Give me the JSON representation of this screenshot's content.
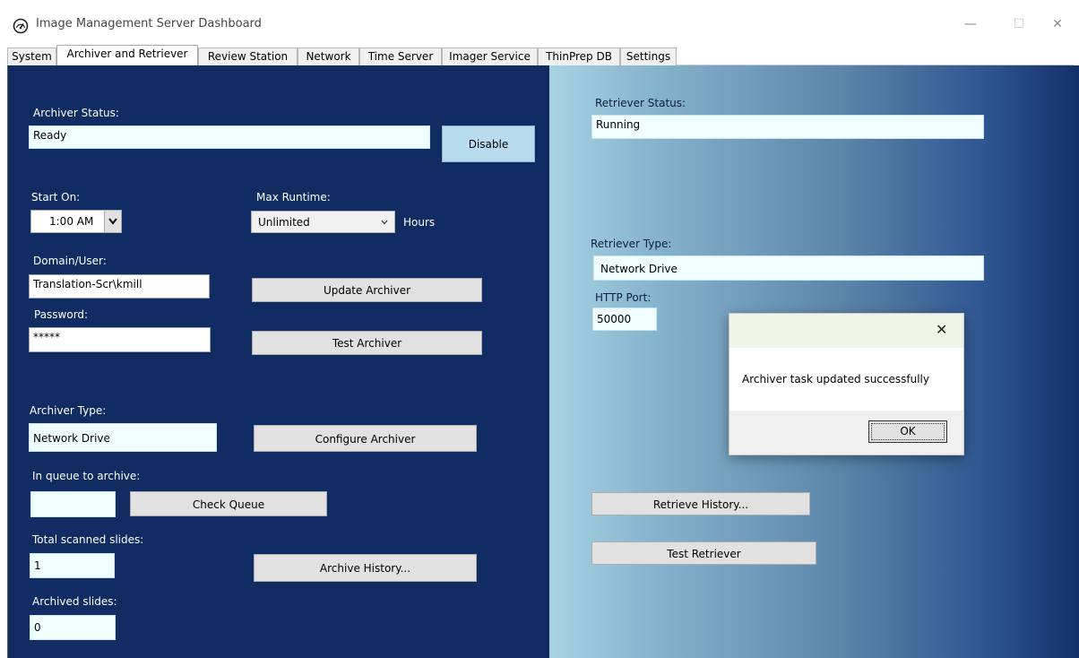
{
  "window": {
    "title": "Image Management Server Dashboard",
    "controls": {
      "minimize": "—",
      "maximize": "☐",
      "close": "✕"
    }
  },
  "tabs": [
    {
      "label": "System"
    },
    {
      "label": "Archiver and Retriever"
    },
    {
      "label": "Review Station"
    },
    {
      "label": "Network"
    },
    {
      "label": "Time Server"
    },
    {
      "label": "Imager Service"
    },
    {
      "label": "ThinPrep DB"
    },
    {
      "label": "Settings"
    }
  ],
  "active_tab": "Archiver and Retriever",
  "archiver": {
    "status_label": "Archiver Status:",
    "status_value": "Ready",
    "disable_button": "Disable",
    "start_on_label": "Start On:",
    "start_on_value": "1:00 AM",
    "max_runtime_label": "Max Runtime:",
    "max_runtime_value": "Unlimited",
    "hours_label": "Hours",
    "domain_user_label": "Domain/User:",
    "domain_user_value": "Translation-Scr\\kmill",
    "password_label": "Password:",
    "password_value": "*****",
    "update_button": "Update Archiver",
    "test_button": "Test Archiver",
    "type_label": "Archiver Type:",
    "type_value": "Network Drive",
    "configure_button": "Configure Archiver",
    "queue_label": "In queue to archive:",
    "queue_value": "",
    "check_queue_button": "Check Queue",
    "total_scanned_label": "Total scanned slides:",
    "total_scanned_value": "1",
    "archive_history_button": "Archive History...",
    "archived_label": "Archived slides:",
    "archived_value": "0"
  },
  "retriever": {
    "status_label": "Retriever Status:",
    "status_value": "Running",
    "type_label": "Retriever Type:",
    "type_value": "Network Drive",
    "http_port_label": "HTTP Port:",
    "http_port_value": "50000",
    "history_button": "Retrieve History...",
    "test_button": "Test Retriever"
  },
  "dialog": {
    "message": "Archiver task updated successfully",
    "ok_button": "OK",
    "close_glyph": "✕"
  },
  "colors": {
    "left_panel": "#102c62",
    "field_bg": "#f0fdff",
    "button_bg": "#e1e1e1",
    "disable_button_bg": "#b9dbee"
  }
}
